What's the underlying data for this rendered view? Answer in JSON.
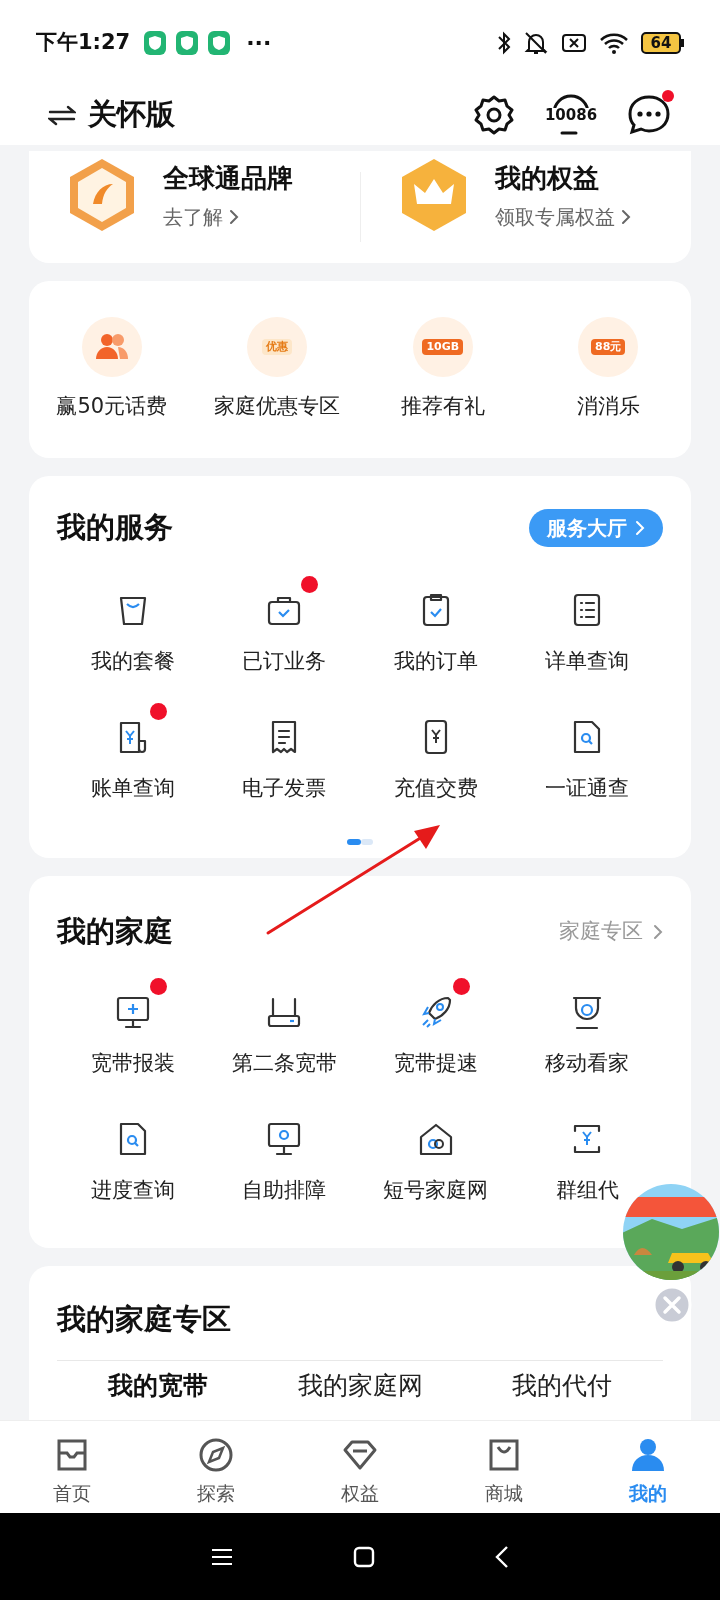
{
  "status_bar": {
    "time": "下午1:27",
    "more": "···",
    "battery": "64"
  },
  "header": {
    "mode_label": "关怀版",
    "hotline": "10086",
    "messages_unread": true
  },
  "brand_card": [
    {
      "title": "全球通品牌",
      "subtitle": "去了解"
    },
    {
      "title": "我的权益",
      "subtitle": "领取专属权益"
    }
  ],
  "promos": [
    {
      "label": "赢50元话费"
    },
    {
      "label": "家庭优惠专区",
      "icon_text": "优惠"
    },
    {
      "label": "推荐有礼",
      "icon_text": "10GB"
    },
    {
      "label": "消消乐",
      "icon_text": "88元"
    }
  ],
  "services": {
    "title": "我的服务",
    "link": "服务大厅",
    "items": [
      {
        "label": "我的套餐",
        "badge": false
      },
      {
        "label": "已订业务",
        "badge": true
      },
      {
        "label": "我的订单",
        "badge": false
      },
      {
        "label": "详单查询",
        "badge": false
      },
      {
        "label": "账单查询",
        "badge": true
      },
      {
        "label": "电子发票",
        "badge": false
      },
      {
        "label": "充值交费",
        "badge": false
      },
      {
        "label": "一证通查",
        "badge": false
      }
    ],
    "pager": [
      {
        "selected": true
      },
      {
        "selected": false
      }
    ]
  },
  "family": {
    "title": "我的家庭",
    "link": "家庭专区",
    "items": [
      {
        "label": "宽带报装",
        "badge": true
      },
      {
        "label": "第二条宽带",
        "badge": false
      },
      {
        "label": "宽带提速",
        "badge": true
      },
      {
        "label": "移动看家",
        "badge": false
      },
      {
        "label": "进度查询",
        "badge": false
      },
      {
        "label": "自助排障",
        "badge": false
      },
      {
        "label": "短号家庭网",
        "badge": false
      },
      {
        "label": "群组代",
        "badge": false
      }
    ]
  },
  "family_zone": {
    "title": "我的家庭专区",
    "tabs": [
      {
        "label": "我的宽带",
        "selected": true
      },
      {
        "label": "我的家庭网",
        "selected": false
      },
      {
        "label": "我的代付",
        "selected": false
      }
    ]
  },
  "bottom_nav": [
    {
      "label": "首页",
      "selected": false
    },
    {
      "label": "探索",
      "selected": false
    },
    {
      "label": "权益",
      "selected": false
    },
    {
      "label": "商城",
      "selected": false
    },
    {
      "label": "我的",
      "selected": true
    }
  ]
}
